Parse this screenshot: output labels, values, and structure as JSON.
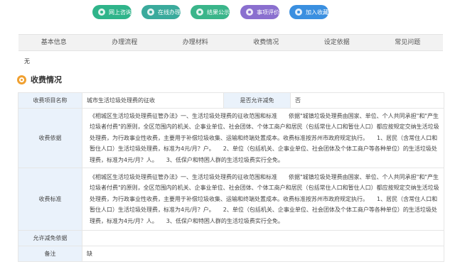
{
  "actions": [
    {
      "label": "网上咨询",
      "color": "#2fb48a",
      "icon": "chat-icon"
    },
    {
      "label": "在线办理",
      "color": "#3aaa9c",
      "icon": "edit-icon"
    },
    {
      "label": "结果公示",
      "color": "#3ab58a",
      "icon": "result-icon"
    },
    {
      "label": "事项评价",
      "color": "#8a6fcf",
      "icon": "rating-icon"
    },
    {
      "label": "加入收藏",
      "color": "#3a8fe0",
      "icon": "star-icon"
    }
  ],
  "tabs": [
    "基本信息",
    "办理流程",
    "办理材料",
    "收费情况",
    "设定依据",
    "常见问题"
  ],
  "prev_section_value": "无",
  "section": {
    "title": "收费情况",
    "icon": "target-icon"
  },
  "table": {
    "item_name_label": "收费项目名称",
    "item_name": "城市生活垃圾处理费的征收",
    "reducible_label": "是否允许减免",
    "reducible": "否",
    "basis_label": "收费依据",
    "basis": "《相城区生活垃圾处理费征管办法》一、生活垃圾处理费的征收范围和标准　　依据\"城镇垃圾处理费由国家、单位、个人共同承担\"和\"产生垃圾者付费\"的原则，全区范围内的机关、企事业单位、社会团体、个体工商户和居民（包括常住人口和暂住人口）都应按规定交纳生活垃圾处理费，为行政事业性收费，主要用于补偿垃圾收集、运输和终端处置成本。收费标准按苏州市政府规定执行。　　1、居民（含常住人口和暂住人口）生活垃圾处理费，标准为4元/月？户。　　2、单位（包括机关、企事业单位、社会团体及个体工商户等各种单位）的生活垃圾处理费，标准为4元/月？人。　　3、低保户和特困人群的生活垃圾费实行全免。",
    "standard_label": "收费标准",
    "standard": "《相城区生活垃圾处理费征管办法》一、生活垃圾处理费的征收范围和标准　　依据\"城镇垃圾处理费由国家、单位、个人共同承担\"和\"产生垃圾者付费\"的原则，全区范围内的机关、企事业单位、社会团体、个体工商户和居民（包括常住人口和暂住人口）都应按规定交纳生活垃圾处理费，为行政事业性收费，主要用于补偿垃圾收集、运输和终端处置成本。收费标准按苏州市政府规定执行。　　1、居民（含常住人口和暂住人口）生活垃圾处理费，标准为4元/月？户。　　2、单位（包括机关、企事业单位、社会团体及个体工商户等各种单位）的生活垃圾处理费，标准为4元/月？人。　　3、低保户和特困人群的生活垃圾费实行全免。",
    "reduction_basis_label": "允许减免依据",
    "reduction_basis": "",
    "remark_label": "备注",
    "remark": "缺"
  }
}
